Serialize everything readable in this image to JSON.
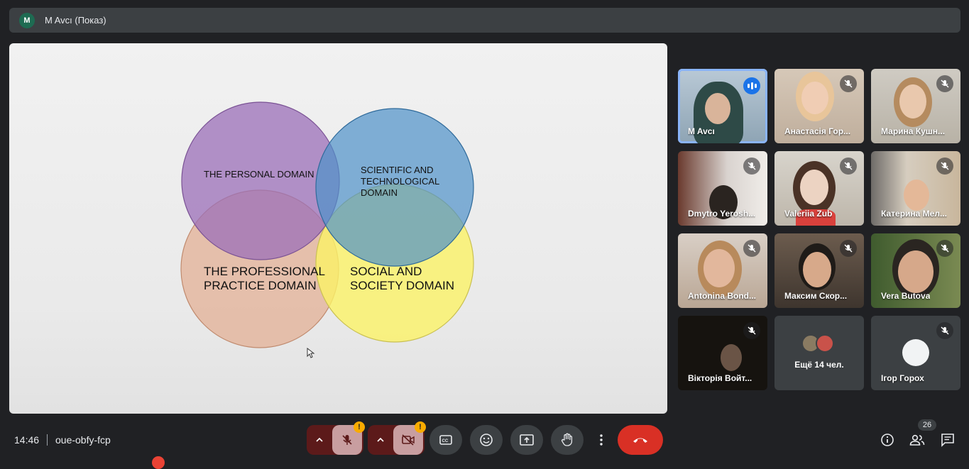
{
  "header": {
    "avatar_letter": "M",
    "presenter_label": "M Avcı (Показ)"
  },
  "slide": {
    "circles": [
      {
        "label_lines": [
          "THE PERSONAL DOMAIN"
        ],
        "color": "#9b6fb8"
      },
      {
        "label_lines": [
          "SCIENTIFIC AND",
          "TECHNOLOGICAL",
          "DOMAIN"
        ],
        "color": "#4f92c9"
      },
      {
        "label_lines": [
          "THE PROFESSIONAL",
          "PRACTICE DOMAIN"
        ],
        "color": "#e8b49a"
      },
      {
        "label_lines": [
          "SOCIAL AND",
          "SOCIETY DOMAIN"
        ],
        "color": "#fbf266"
      }
    ]
  },
  "participants": [
    {
      "name": "M Avcı",
      "speaking": true
    },
    {
      "name": "Анастасія Гор...",
      "muted": true
    },
    {
      "name": "Марина Кушн...",
      "muted": true
    },
    {
      "name": "Dmytro Yerosh...",
      "muted": true
    },
    {
      "name": "Valeriia Zub",
      "muted": true
    },
    {
      "name": "Катерина Мел...",
      "muted": true
    },
    {
      "name": "Antonina Bond...",
      "muted": true
    },
    {
      "name": "Максим Скор...",
      "muted": true
    },
    {
      "name": "Vera Butova",
      "muted": true
    },
    {
      "name": "Вікторія Войт...",
      "muted": true
    },
    {
      "more_label": "Ещё 14 чел."
    },
    {
      "name": "Ігор Горох",
      "muted": true
    }
  ],
  "bottom": {
    "time": "14:46",
    "meeting_code": "oue-obfy-fcp",
    "warning_mark": "!",
    "participants_count": "26"
  },
  "colors": {
    "accent": "#8ab4f8",
    "end_call": "#d93025",
    "warning": "#f9ab00"
  }
}
